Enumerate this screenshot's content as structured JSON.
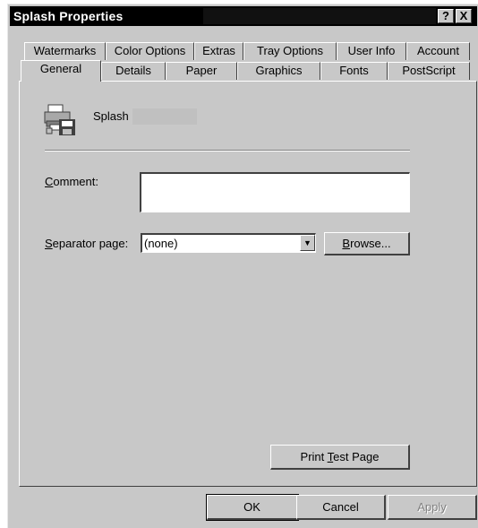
{
  "window": {
    "title": "Splash Properties",
    "help_button": "?",
    "close_button": "X"
  },
  "tabs": {
    "back_row": [
      "Watermarks",
      "Color Options",
      "Extras",
      "Tray Options",
      "User Info",
      "Account"
    ],
    "front_row": [
      "General",
      "Details",
      "Paper",
      "Graphics",
      "Fonts",
      "PostScript"
    ],
    "active": "General"
  },
  "general": {
    "printer_name": "Splash",
    "comment_label_prefix": "",
    "comment_label_mnemonic": "C",
    "comment_label_rest": "omment:",
    "comment_value": "",
    "separator_label_mnemonic": "S",
    "separator_label_rest": "eparator page:",
    "separator_value": "(none)",
    "browse_mnemonic": "B",
    "browse_rest": "rowse...",
    "print_test_prefix": "Print ",
    "print_test_mnemonic": "T",
    "print_test_rest": "est Page"
  },
  "footer": {
    "ok_label": "OK",
    "cancel_label": "Cancel",
    "apply_label": "Apply"
  },
  "icons": {
    "printer": "printer-icon",
    "dropdown": "chevron-down-icon"
  },
  "colors": {
    "face": "#c8c8c8",
    "titlebar": "#000000"
  }
}
